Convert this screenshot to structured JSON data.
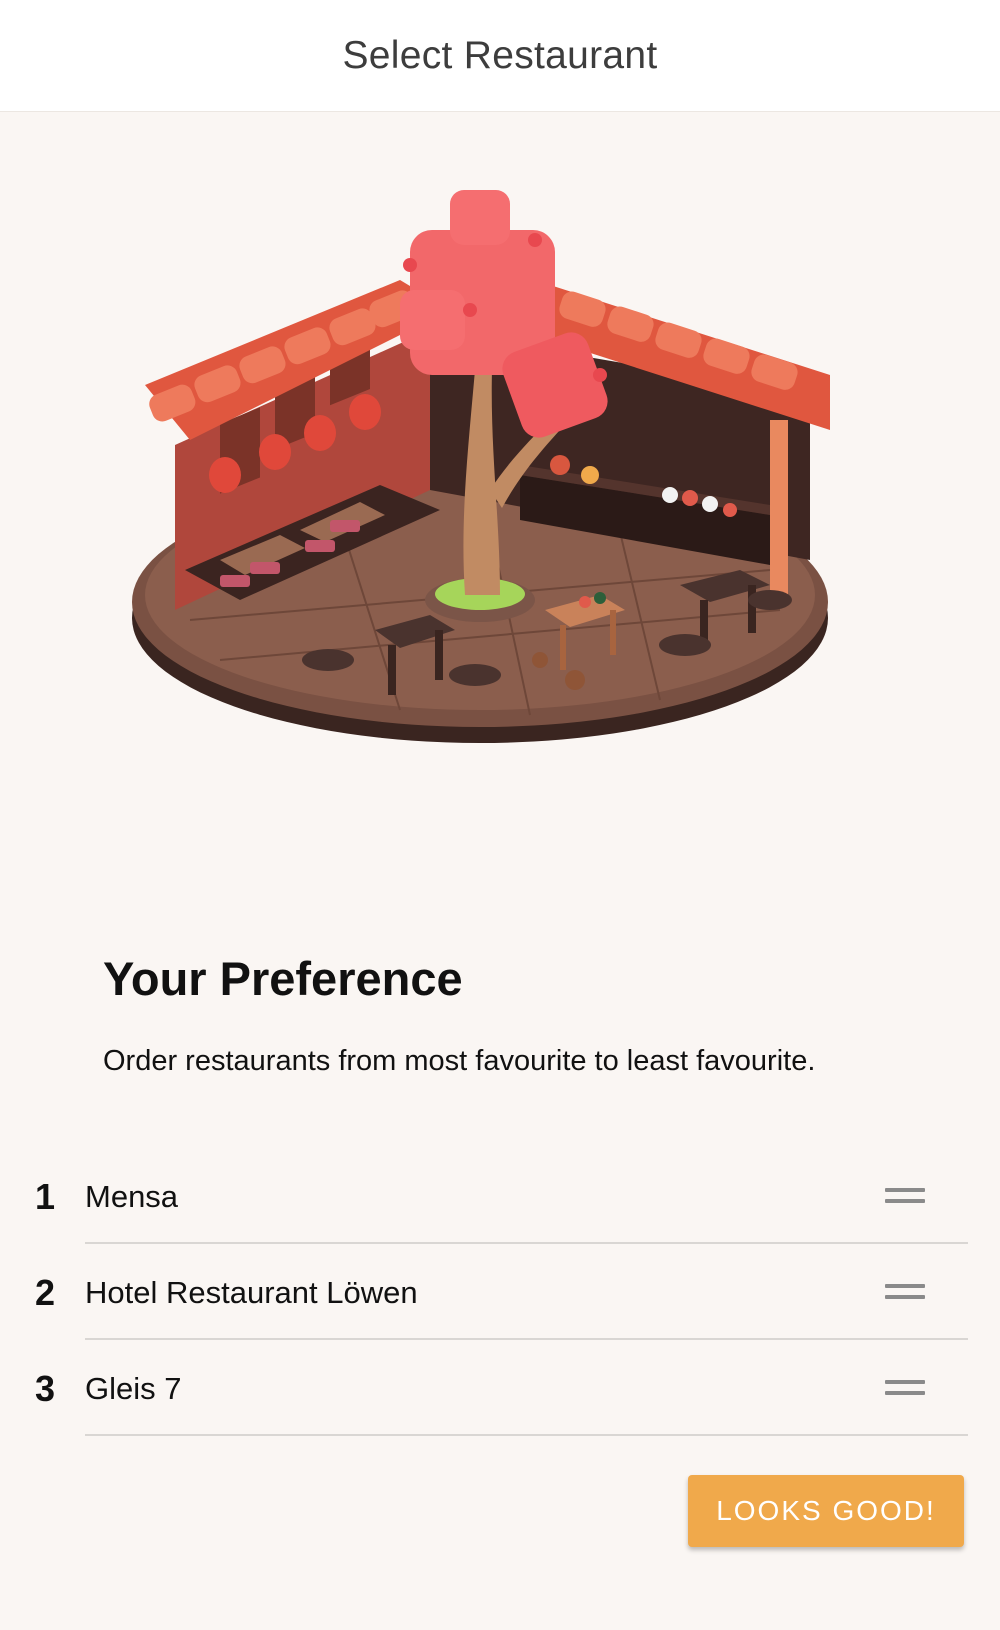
{
  "header": {
    "title": "Select Restaurant"
  },
  "illustration": {
    "icon": "restaurant-scene-illustration"
  },
  "preference": {
    "title": "Your Preference",
    "description": "Order restaurants from most favourite to least favourite."
  },
  "ranking": [
    {
      "rank": "1",
      "name": "Mensa",
      "handle_icon": "drag-handle-icon"
    },
    {
      "rank": "2",
      "name": "Hotel Restaurant Löwen",
      "handle_icon": "drag-handle-icon"
    },
    {
      "rank": "3",
      "name": "Gleis 7",
      "handle_icon": "drag-handle-icon"
    }
  ],
  "actions": {
    "confirm_label": "LOOKS GOOD!"
  },
  "colors": {
    "accent": "#f0a94b",
    "background": "#faf6f3",
    "header_bg": "#ffffff"
  }
}
